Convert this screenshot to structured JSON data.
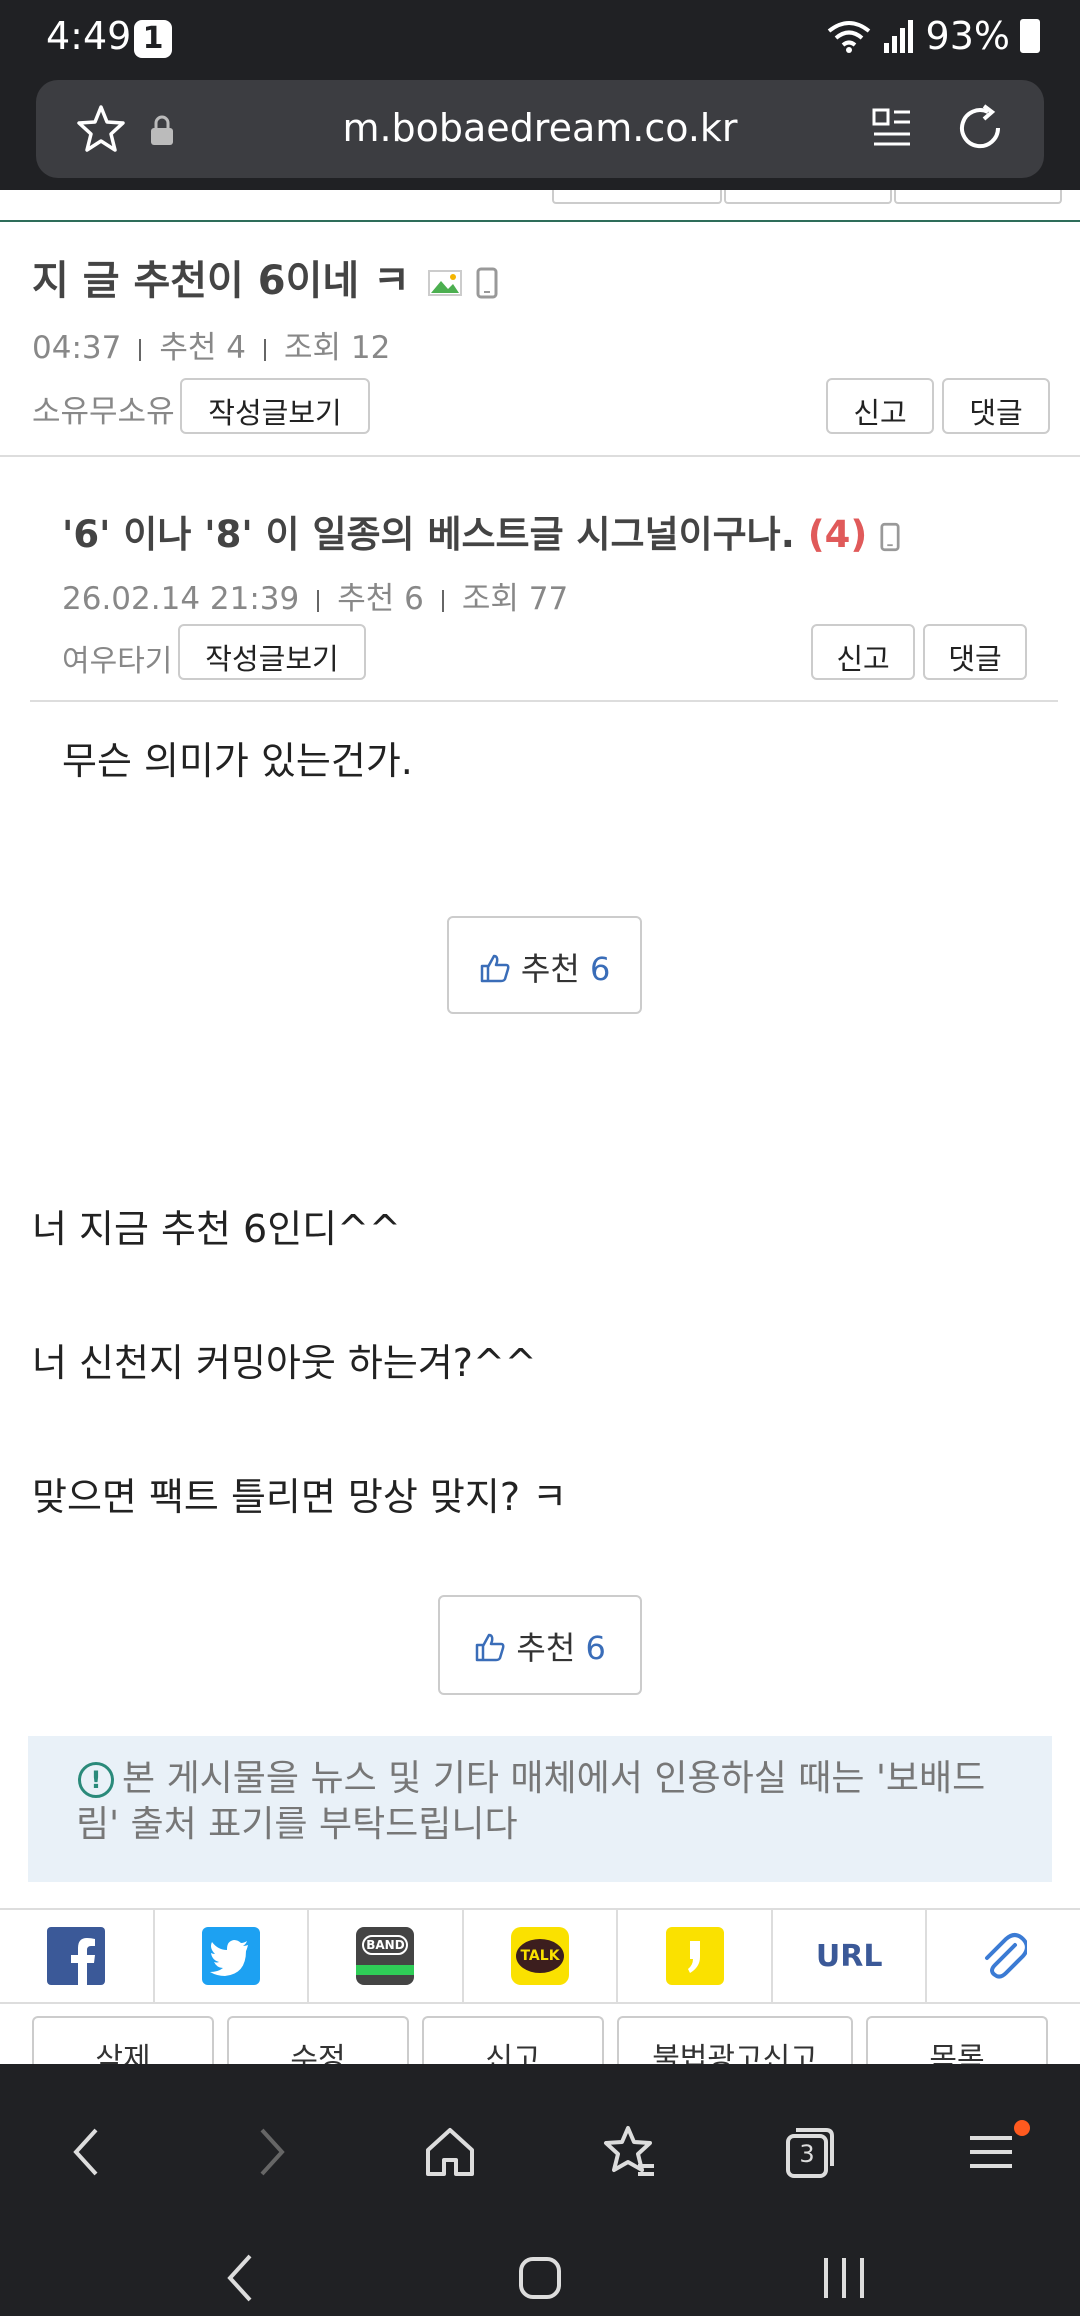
{
  "status_bar": {
    "time": "4:49",
    "notification_count": "1",
    "battery": "93%"
  },
  "browser": {
    "url": "m.bobaedream.co.kr",
    "tab_count": "3"
  },
  "post": {
    "title": "지 글 추천이 6이네 ㅋ",
    "time": "04:37",
    "recommend": "추천 4",
    "views": "조회 12",
    "author": "소유무소유",
    "view_posts_label": "작성글보기",
    "report_label": "신고",
    "reply_label": "댓글"
  },
  "quoted_post": {
    "title": "'6' 이나 '8' 이 일종의 베스트글 시그널이구나.",
    "comment_count": "(4)",
    "date": "26.02.14  21:39",
    "recommend": "추천 6",
    "views": "조회 77",
    "author": "여우타기",
    "view_posts_label": "작성글보기",
    "report_label": "신고",
    "reply_label": "댓글",
    "body": "무슨 의미가 있는건가.",
    "rec_label": "추천",
    "rec_count": "6"
  },
  "body_lines": [
    "너 지금 추천 6인디^^",
    "너 신천지 커밍아웃 하는겨?^^",
    "맞으면 팩트 틀리면 망상 맞지? ㅋ"
  ],
  "recommend_button": {
    "label": "추천",
    "count": "6"
  },
  "notice": {
    "line1": "본 게시물을 뉴스 및 기타 매체에서 인용하실 때는 '보배드",
    "line2": "림' 출처 표기를 부탁드립니다"
  },
  "share": {
    "items": [
      "facebook",
      "twitter",
      "band",
      "kakaotalk",
      "kakaostory",
      "url",
      "clip"
    ],
    "band_label": "BAND",
    "talk_label": "TALK",
    "url_label": "URL"
  },
  "actions": [
    "삭제",
    "수정",
    "신고",
    "불법광고신고",
    "목록"
  ],
  "colors": {
    "accent_red": "#e05a5a",
    "recommend_blue": "#3a6db8",
    "notice_bg": "#e9f1f8",
    "facebook": "#3b5998",
    "twitter": "#1da1f2",
    "kakao": "#fae100"
  }
}
